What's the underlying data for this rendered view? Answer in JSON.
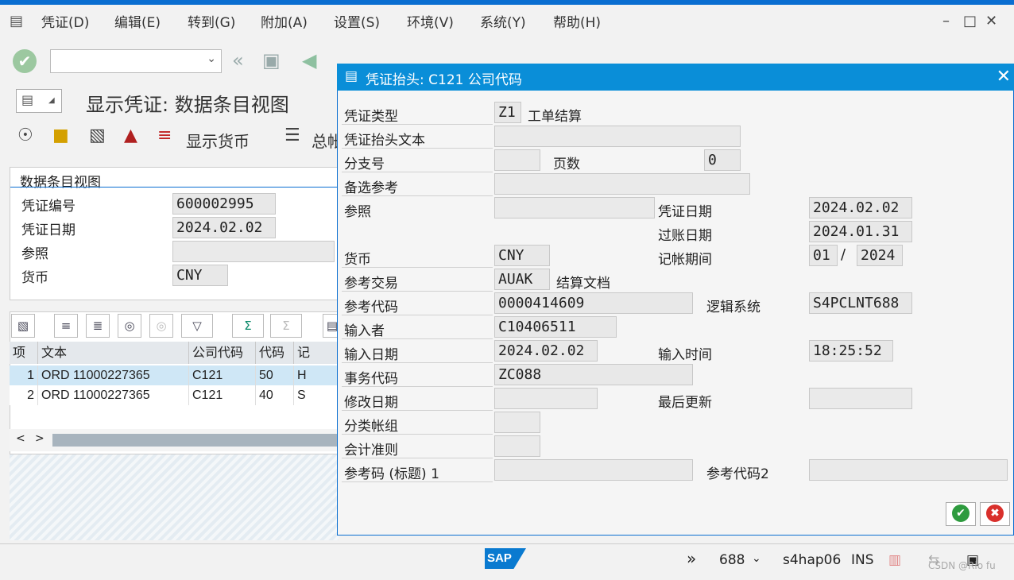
{
  "menu": {
    "items": [
      "凭证(D)",
      "编辑(E)",
      "转到(G)",
      "附加(A)",
      "设置(S)",
      "环境(V)",
      "系统(Y)",
      "帮助(H)"
    ]
  },
  "page": {
    "title": "显示凭证: 数据条目视图",
    "toolbar_display_currency": "显示货币",
    "toolbar_general_ledger": "总帐"
  },
  "left_panel": {
    "section_title": "数据条目视图",
    "doc_number_label": "凭证编号",
    "doc_number_value": "600002995",
    "doc_date_label": "凭证日期",
    "doc_date_value": "2024.02.02",
    "reference_label": "参照",
    "reference_value": "",
    "currency_label": "货币",
    "currency_value": "CNY"
  },
  "grid": {
    "headers": [
      "项",
      "文本",
      "公司代码",
      "代码",
      "记"
    ],
    "rows": [
      [
        "1",
        "ORD 11000227365",
        "C121",
        "50",
        "H"
      ],
      [
        "2",
        "ORD 11000227365",
        "C121",
        "40",
        "S"
      ]
    ]
  },
  "dialog": {
    "title": "凭证抬头: C121 公司代码",
    "doc_type_label": "凭证类型",
    "doc_type_value": "Z1",
    "doc_type_desc": "工单结算",
    "header_text_label": "凭证抬头文本",
    "header_text_value": "",
    "branch_label": "分支号",
    "branch_value": "",
    "pages_label": "页数",
    "pages_value": "0",
    "alt_ref_label": "备选参考",
    "alt_ref_value": "",
    "reference_label": "参照",
    "reference_value": "",
    "doc_date_label": "凭证日期",
    "doc_date_value": "2024.02.02",
    "posting_date_label": "过账日期",
    "posting_date_value": "2024.01.31",
    "currency_label": "货币",
    "currency_value": "CNY",
    "period_label": "记帐期间",
    "period_value": "01",
    "period_sep": "/",
    "period_year": "2024",
    "ref_trans_label": "参考交易",
    "ref_trans_value": "AUAK",
    "ref_trans_desc": "结算文档",
    "ref_key_label": "参考代码",
    "ref_key_value": "0000414609",
    "logical_sys_label": "逻辑系统",
    "logical_sys_value": "S4PCLNT688",
    "entered_by_label": "输入者",
    "entered_by_value": "C10406511",
    "entry_date_label": "输入日期",
    "entry_date_value": "2024.02.02",
    "entry_time_label": "输入时间",
    "entry_time_value": "18:25:52",
    "tcode_label": "事务代码",
    "tcode_value": "ZC088",
    "changed_on_label": "修改日期",
    "changed_on_value": "",
    "last_update_label": "最后更新",
    "last_update_value": "",
    "ledger_group_label": "分类帐组",
    "ledger_group_value": "",
    "acct_principle_label": "会计准则",
    "acct_principle_value": "",
    "ref_key1_label": "参考码 (标题) 1",
    "ref_key1_value": "",
    "ref_key2_label": "参考代码2",
    "ref_key2_value": ""
  },
  "status": {
    "client": "688",
    "server": "s4hap06",
    "mode": "INS",
    "brand": "SAP",
    "watermark": "CSDN @Rio fu"
  },
  "colors": {
    "accent": "#0a8ed8",
    "row_selected": "#cfe7f6",
    "ok_green": "#2e9b3e",
    "cancel_red": "#d9302c"
  }
}
